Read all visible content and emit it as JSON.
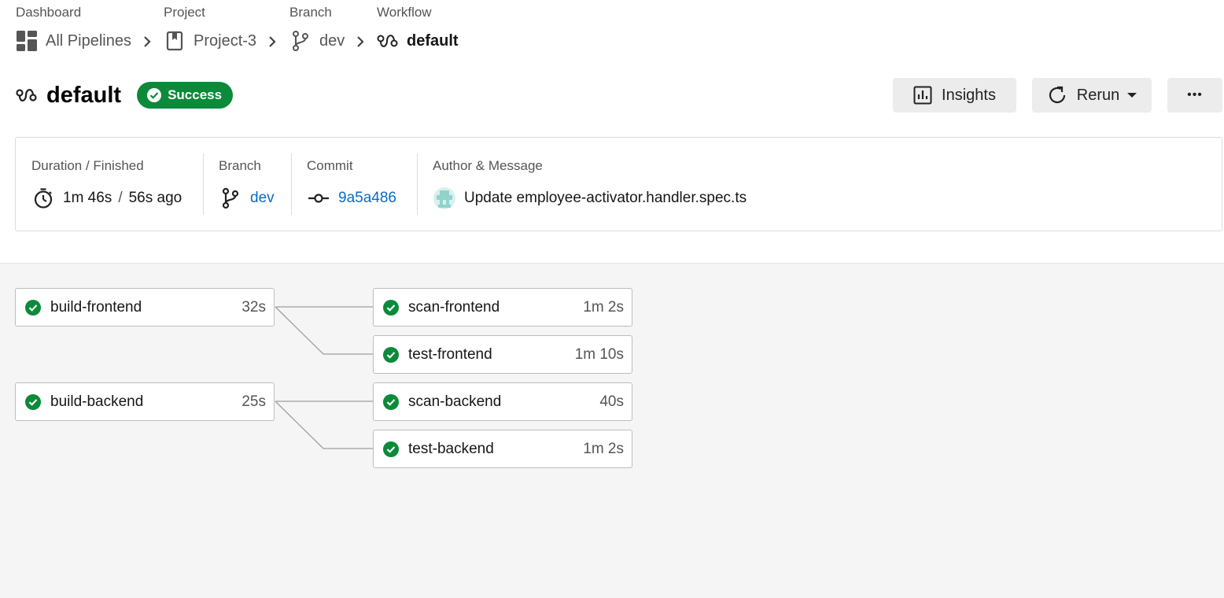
{
  "breadcrumb": {
    "dashboard": {
      "label": "Dashboard",
      "value": "All Pipelines"
    },
    "project": {
      "label": "Project",
      "value": "Project-3"
    },
    "branch": {
      "label": "Branch",
      "value": "dev"
    },
    "workflow": {
      "label": "Workflow",
      "value": "default"
    }
  },
  "header": {
    "title": "default",
    "status": "Success",
    "insights_label": "Insights",
    "rerun_label": "Rerun",
    "more_label": "•••"
  },
  "summary": {
    "duration_label": "Duration / Finished",
    "duration": "1m 46s",
    "separator": "/",
    "finished": "56s ago",
    "branch_label": "Branch",
    "branch": "dev",
    "commit_label": "Commit",
    "commit": "9a5a486",
    "author_label": "Author & Message",
    "message": "Update employee-activator.handler.spec.ts"
  },
  "jobs": [
    {
      "name": "build-frontend",
      "duration": "32s",
      "status": "success"
    },
    {
      "name": "scan-frontend",
      "duration": "1m 2s",
      "status": "success"
    },
    {
      "name": "test-frontend",
      "duration": "1m 10s",
      "status": "success"
    },
    {
      "name": "build-backend",
      "duration": "25s",
      "status": "success"
    },
    {
      "name": "scan-backend",
      "duration": "40s",
      "status": "success"
    },
    {
      "name": "test-backend",
      "duration": "1m 2s",
      "status": "success"
    }
  ],
  "colors": {
    "success": "#0b8a3a",
    "link": "#0a6cc4",
    "canvas": "#f5f5f5"
  }
}
